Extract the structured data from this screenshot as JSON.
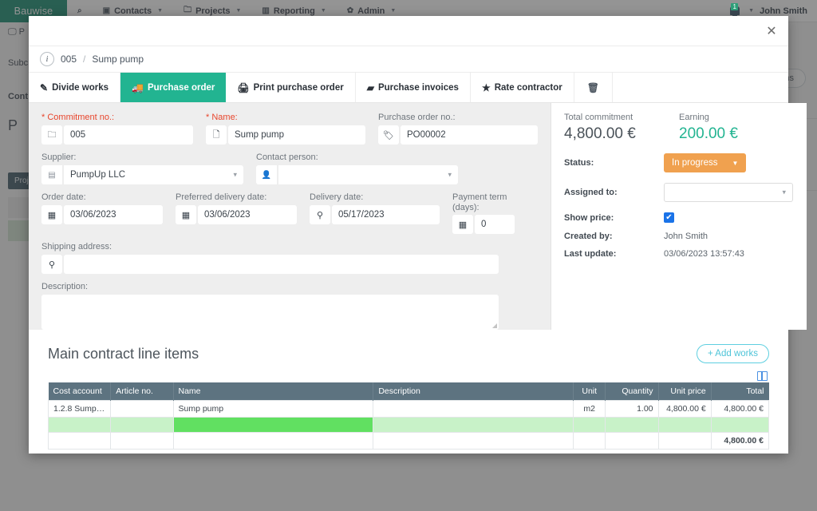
{
  "topnav": {
    "brand": "Bauwise",
    "search_icon": "search-icon",
    "items": [
      {
        "label": "Contacts",
        "icon": "contacts-icon"
      },
      {
        "label": "Projects",
        "icon": "folder-icon"
      },
      {
        "label": "Reporting",
        "icon": "chart-icon"
      },
      {
        "label": "Admin",
        "icon": "gear-icon"
      }
    ],
    "notification_count": "1",
    "user": "John Smith"
  },
  "background": {
    "rows": [
      "P",
      "Subc",
      "Cont",
      "P"
    ],
    "chip": "Proje",
    "pill": "ons"
  },
  "modal": {
    "close_label": "✕",
    "breadcrumb": {
      "info": "i",
      "number": "005",
      "separator": "/",
      "name": "Sump pump"
    },
    "tabs": [
      {
        "label": "Divide works",
        "icon": "pencil-icon",
        "active": false
      },
      {
        "label": "Purchase order",
        "icon": "truck-icon",
        "active": true
      },
      {
        "label": "Print purchase order",
        "icon": "printer-icon",
        "active": false
      },
      {
        "label": "Purchase invoices",
        "icon": "invoice-icon",
        "active": false
      },
      {
        "label": "Rate contractor",
        "icon": "star-icon",
        "active": false
      }
    ],
    "delete_icon": "trash-icon",
    "form": {
      "commitment_label": "Commitment no.:",
      "commitment_value": "005",
      "commitment_icon": "folder-icon",
      "name_label": "Name:",
      "name_value": "Sump pump",
      "name_icon": "document-icon",
      "po_label": "Purchase order no.:",
      "po_value": "PO00002",
      "po_icon": "tag-icon",
      "supplier_label": "Supplier:",
      "supplier_value": "PumpUp LLC",
      "supplier_icon": "building-icon",
      "contact_label": "Contact person:",
      "contact_value": "",
      "contact_icon": "person-icon",
      "order_date_label": "Order date:",
      "order_date_value": "03/06/2023",
      "order_date_icon": "calendar-icon",
      "preferred_label": "Preferred delivery date:",
      "preferred_value": "03/06/2023",
      "preferred_icon": "calendar-icon",
      "delivery_label": "Delivery date:",
      "delivery_value": "05/17/2023",
      "delivery_icon": "pin-icon",
      "payment_label": "Payment term (days):",
      "payment_value": "0",
      "payment_icon": "calendar-icon",
      "shipping_label": "Shipping address:",
      "shipping_value": "",
      "shipping_icon": "pin-icon",
      "description_label": "Description:",
      "description_value": ""
    },
    "summary": {
      "total_commitment_label": "Total commitment",
      "total_commitment_value": "4,800.00 €",
      "earning_label": "Earning",
      "earning_value": "200.00 €",
      "status_label": "Status:",
      "status_value": "In progress",
      "assigned_label": "Assigned to:",
      "assigned_value": "",
      "show_price_label": "Show price:",
      "show_price_checked": "✔",
      "created_by_label": "Created by:",
      "created_by_value": "John Smith",
      "last_update_label": "Last update:",
      "last_update_value": "03/06/2023 13:57:43"
    },
    "line_items": {
      "title": "Main contract line items",
      "add_button": "+ Add works",
      "column_picker_icon": "columns-icon",
      "columns": [
        "Cost account",
        "Article no.",
        "Name",
        "Description",
        "Unit",
        "Quantity",
        "Unit price",
        "Total"
      ],
      "rows": [
        {
          "cost_account": "1.2.8 Sump p...",
          "article_no": "",
          "name": "Sump pump",
          "description": "",
          "unit": "m2",
          "quantity": "1.00",
          "unit_price": "4,800.00 €",
          "total": "4,800.00 €"
        }
      ],
      "selected_row": {
        "cost_account": "",
        "article_no": "",
        "name": "",
        "description": "",
        "unit": "",
        "quantity": "",
        "unit_price": "",
        "total": ""
      },
      "total_row": {
        "cost_account": "",
        "article_no": "",
        "name": "",
        "description": "",
        "unit": "",
        "quantity": "",
        "unit_price": "",
        "total": "4,800.00 €"
      }
    }
  },
  "colors": {
    "brand_green": "#128a6e",
    "tab_active": "#22b491",
    "status_orange": "#f0a14f",
    "table_header": "#5d7380",
    "accent_cyan": "#5ecfe0",
    "required_red": "#e8452c"
  }
}
